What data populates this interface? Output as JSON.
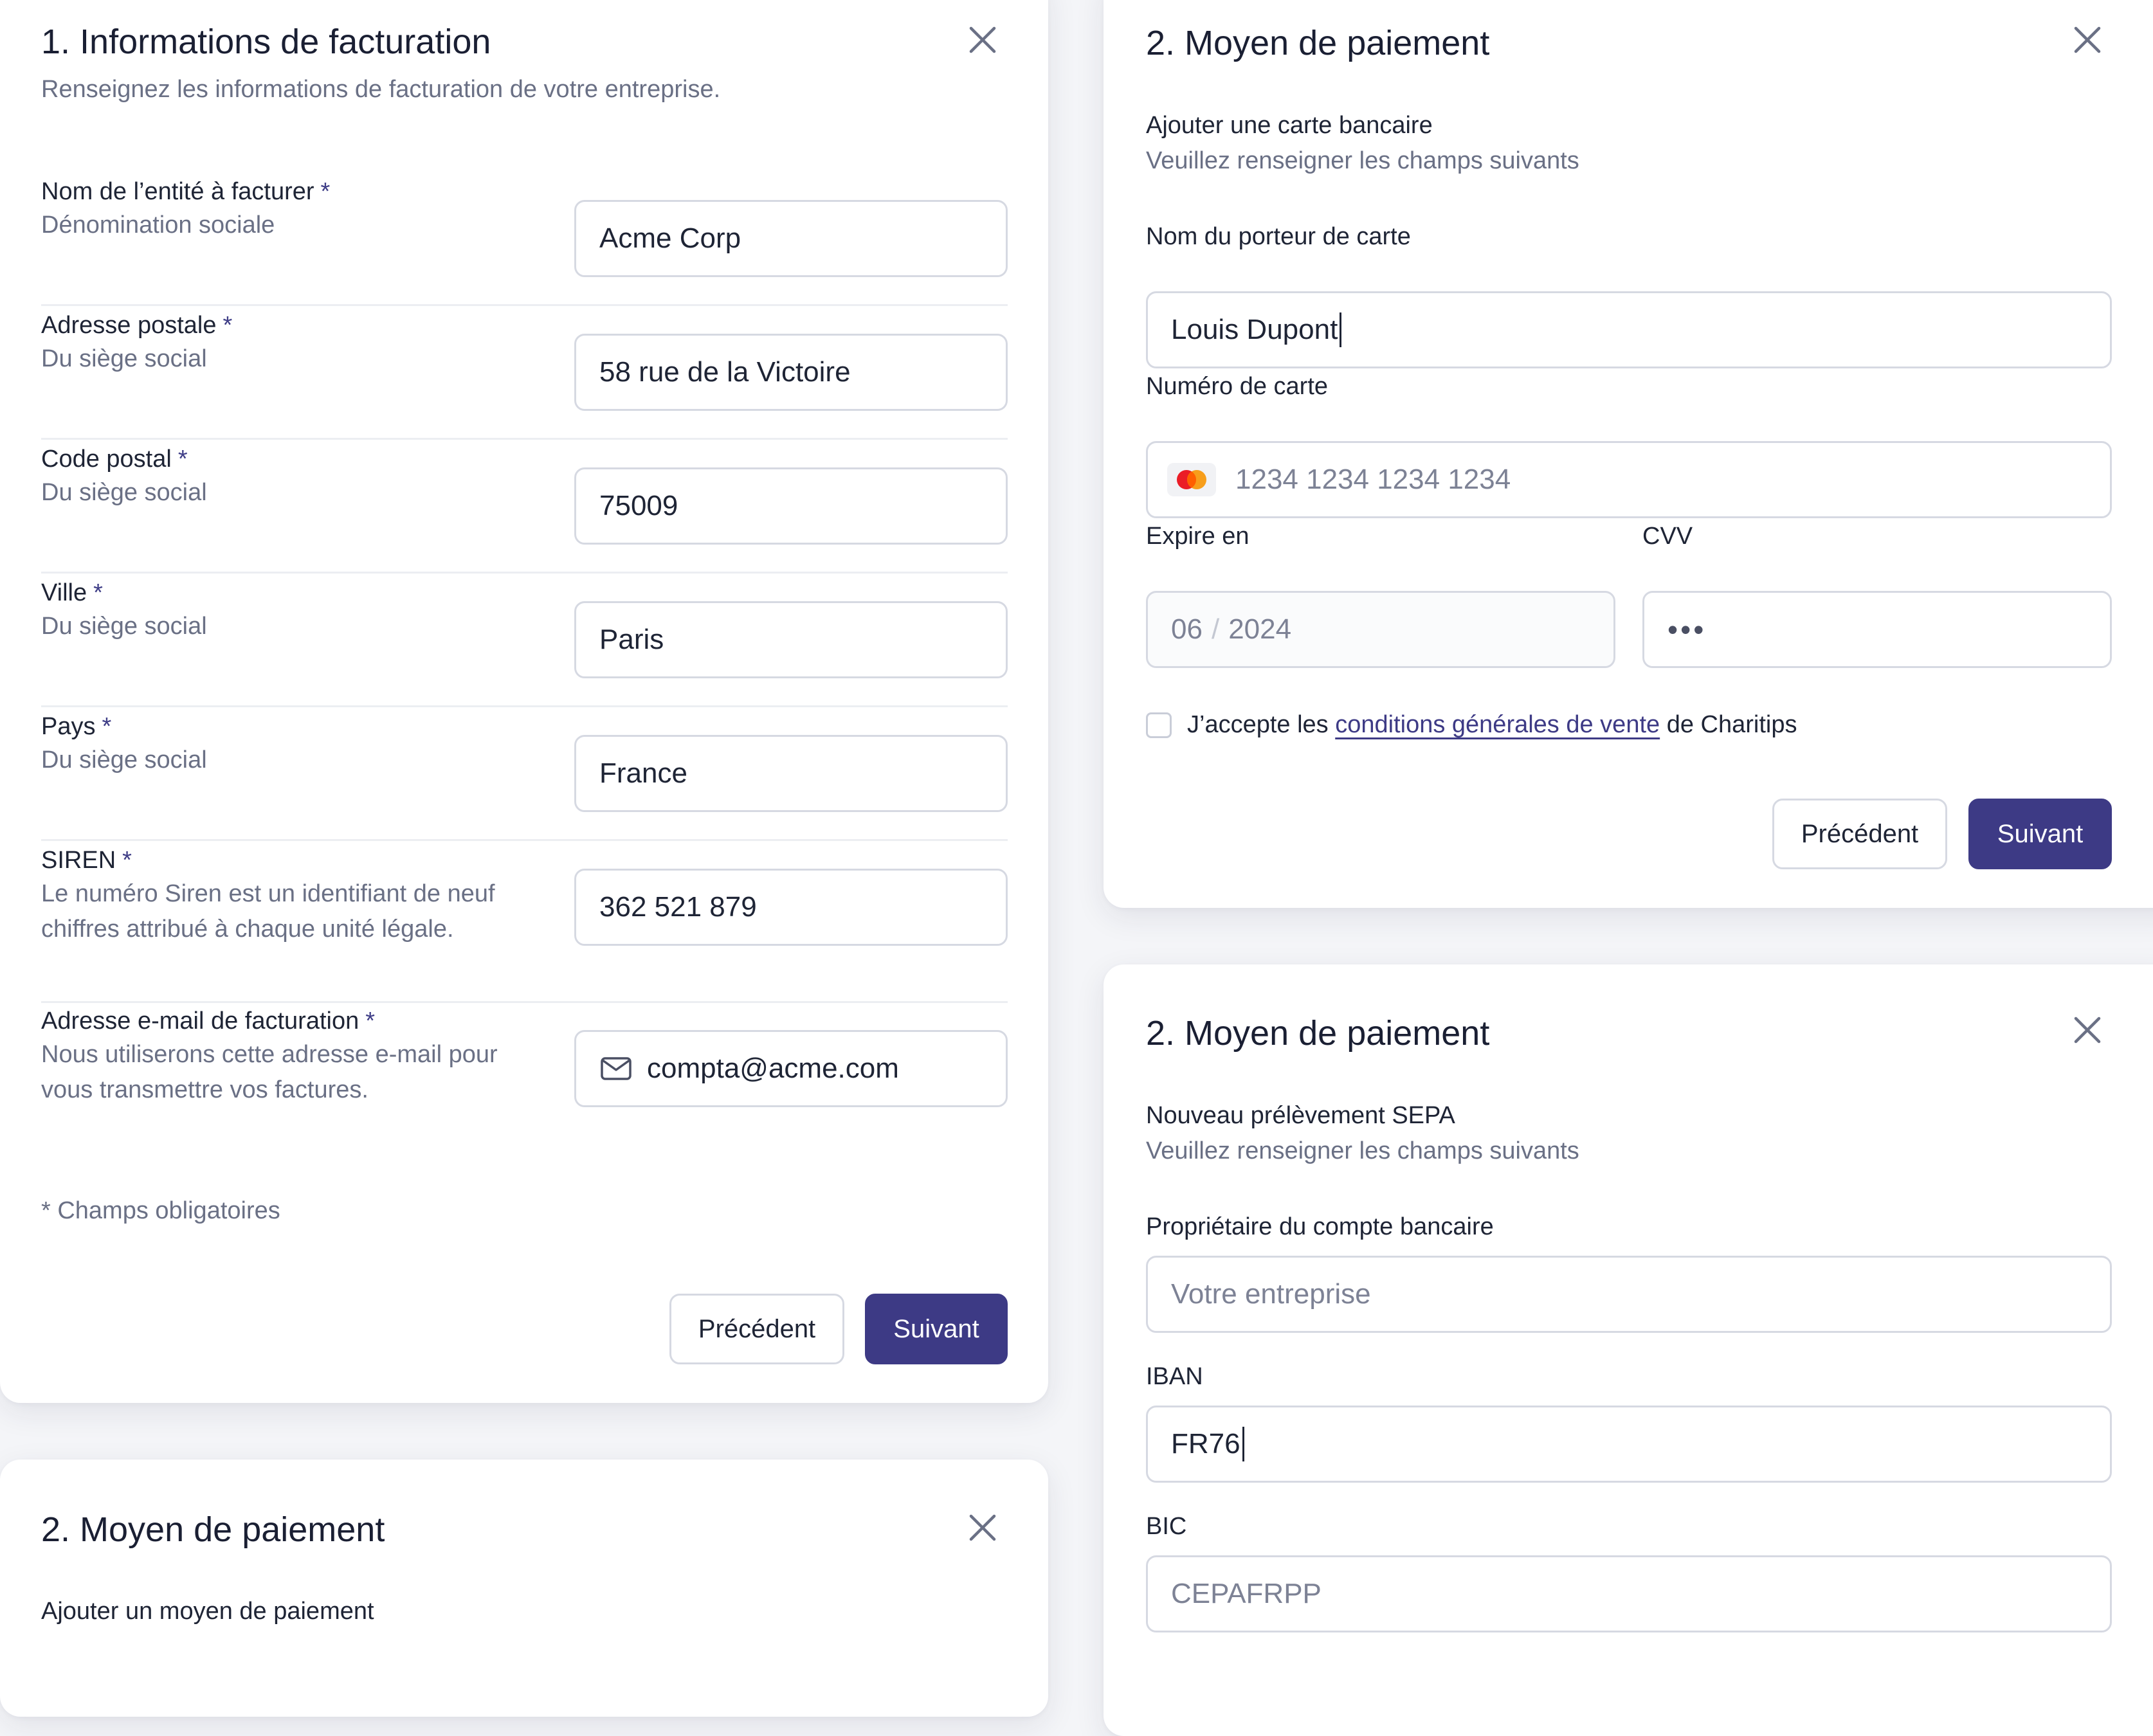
{
  "billing": {
    "title": "1. Informations de facturation",
    "subtitle": "Renseignez les informations de facturation de votre entreprise.",
    "required_mark": "*",
    "fields": [
      {
        "label": "Nom de l’entité à facturer",
        "hint": "Dénomination sociale",
        "value": "Acme Corp"
      },
      {
        "label": "Adresse postale",
        "hint": "Du siège social",
        "value": "58 rue de la Victoire"
      },
      {
        "label": "Code postal",
        "hint": "Du siège social",
        "value": "75009"
      },
      {
        "label": "Ville",
        "hint": "Du siège social",
        "value": "Paris"
      },
      {
        "label": "Pays",
        "hint": "Du siège social",
        "value": "France"
      },
      {
        "label": "SIREN",
        "hint": "Le numéro Siren est un identifiant de neuf chiffres attribué à chaque unité légale.",
        "value": "362 521 879"
      },
      {
        "label": "Adresse e-mail de facturation",
        "hint": "Nous utiliserons cette adresse e-mail pour vous transmettre vos factures.",
        "value": "compta@acme.com",
        "icon": "mail-icon"
      }
    ],
    "required_note": "* Champs obligatoires",
    "prev_label": "Précédent",
    "next_label": "Suivant"
  },
  "payment_intro": {
    "title": "2. Moyen de paiement",
    "section_title": "Ajouter un moyen de paiement"
  },
  "card_payment": {
    "title": "2. Moyen de paiement",
    "section_title": "Ajouter une carte bancaire",
    "section_hint": "Veuillez renseigner les champs suivants",
    "holder_label": "Nom du porteur de carte",
    "holder_value": "Louis Dupont",
    "number_label": "Numéro de carte",
    "number_placeholder": "1234 1234 1234 1234",
    "number_icon": "mastercard-icon",
    "expiry_label": "Expire en",
    "expiry_month": "06",
    "expiry_sep": "/",
    "expiry_year": "2024",
    "cvv_label": "CVV",
    "cvv_value": "•••",
    "terms_prefix": "J’accepte les",
    "terms_link": "conditions générales de vente",
    "terms_suffix": "de Charitips",
    "terms_checked": false,
    "prev_label": "Précédent",
    "next_label": "Suivant"
  },
  "sepa_payment": {
    "title": "2. Moyen de paiement",
    "section_title": "Nouveau prélèvement SEPA",
    "section_hint": "Veuillez renseigner les champs suivants",
    "owner_label": "Propriétaire du compte bancaire",
    "owner_placeholder": "Votre entreprise",
    "iban_label": "IBAN",
    "iban_value": "FR76",
    "bic_label": "BIC",
    "bic_placeholder": "CEPAFRPP"
  },
  "colors": {
    "primary": "#3d3a85",
    "text": "#1e2435",
    "muted": "#6a7085",
    "border": "#d6d9e2",
    "background": "#f4f5f8"
  }
}
